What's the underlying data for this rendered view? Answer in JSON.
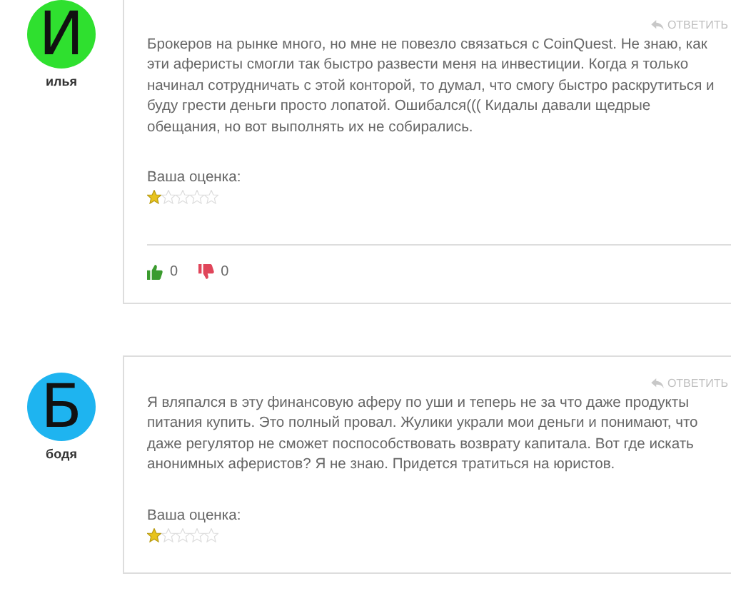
{
  "comments": [
    {
      "avatar_letter": "И",
      "color": "#2fe02f",
      "author": "илья",
      "reply": "ОТВЕТИТЬ",
      "text": "Брокеров на рынке много, но мне не повезло связаться с CoinQuest. Не знаю, как эти аферисты смогли так быстро развести меня на инвестиции. Когда я только начинал сотрудничать с этой конторой, то думал, что смогу быстро раскрутиться и буду грести деньги просто лопатой. Ошибался((( Кидалы давали щедрые обещания, но вот выполнять их не собирались.",
      "rating_label": "Ваша оценка:",
      "stars": 1,
      "votes": {
        "likes": "0",
        "dislikes": "0"
      }
    },
    {
      "avatar_letter": "Б",
      "color": "#1eb4f0",
      "author": "бодя",
      "reply": "ОТВЕТИТЬ",
      "text": "Я вляпался в эту финансовую аферу по уши и теперь не за что даже продукты питания купить. Это полный провал. Жулики украли мои деньги и понимают, что даже регулятор не сможет поспособствовать возврату капитала. Вот где искать анонимных аферистов? Я не знаю. Придется тратиться на юристов.",
      "rating_label": "Ваша оценка:",
      "stars": 1
    }
  ]
}
